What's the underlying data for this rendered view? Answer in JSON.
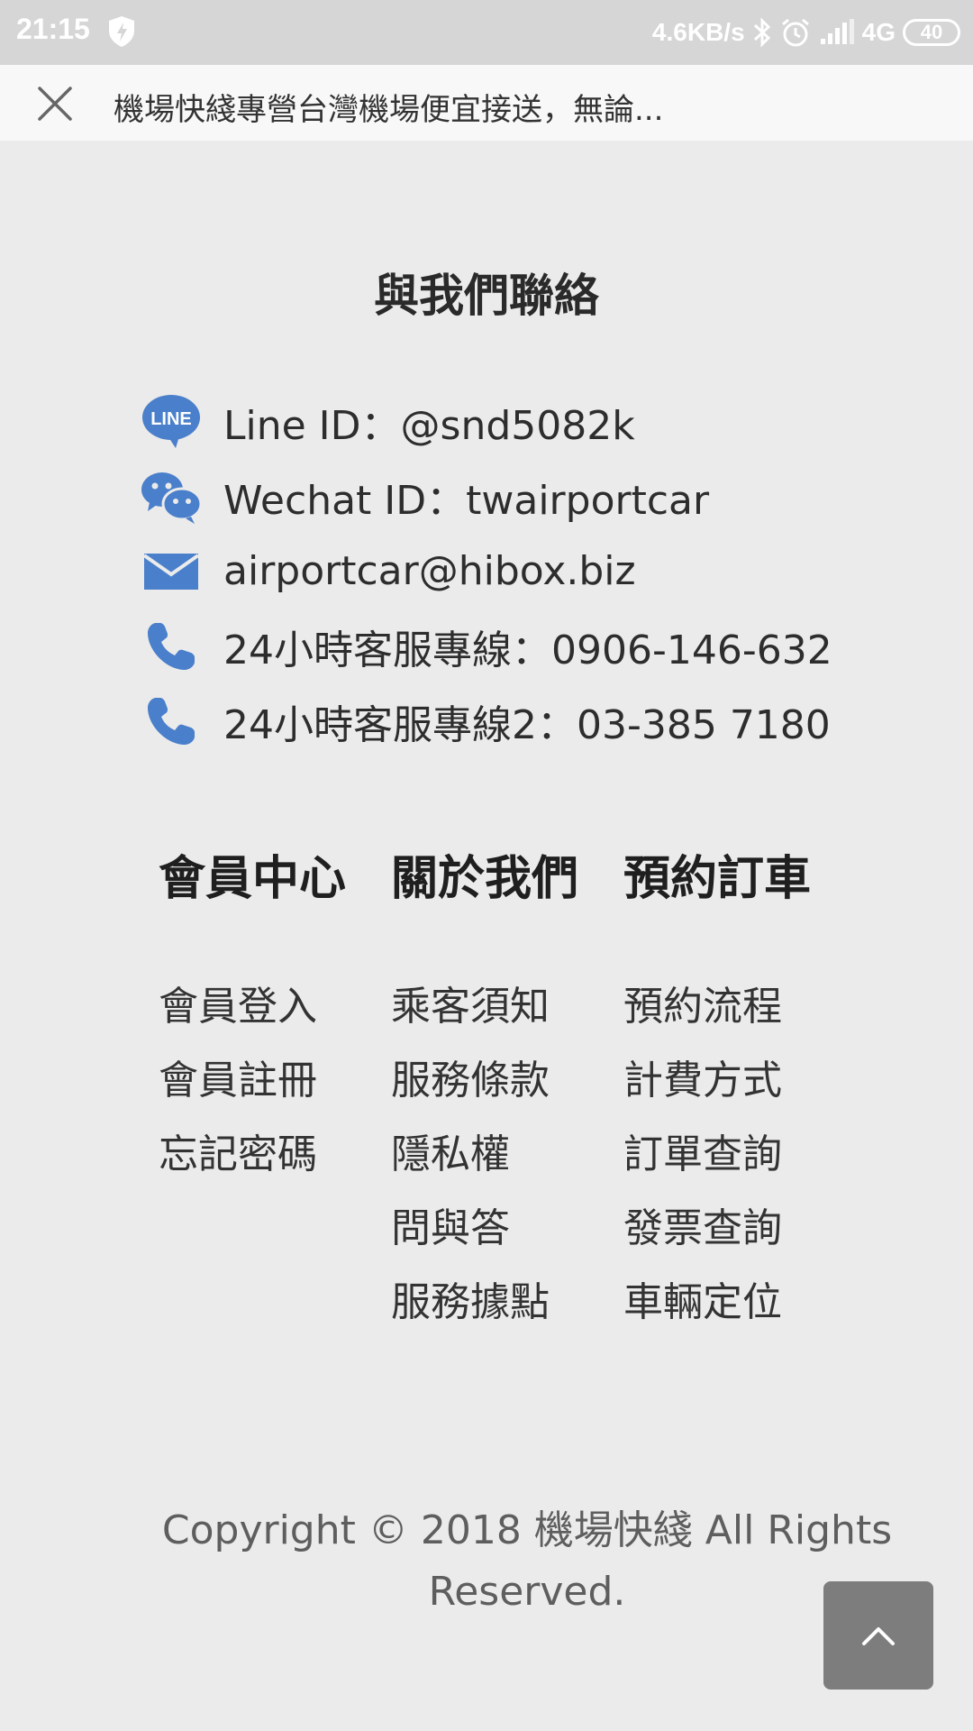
{
  "status_bar": {
    "time": "21:15",
    "net_speed": "4.6KB/s",
    "network": "4G",
    "battery": "40",
    "icons": [
      "shield-icon",
      "bluetooth-icon",
      "alarm-icon",
      "signal-icon"
    ]
  },
  "title_bar": {
    "title": "機場快綫專營台灣機場便宜接送，無論...",
    "close_icon": "close-icon"
  },
  "contact": {
    "heading": "與我們聯絡",
    "items": [
      {
        "icon": "line-icon",
        "text": "Line ID：@snd5082k"
      },
      {
        "icon": "wechat-icon",
        "text": "Wechat ID：twairportcar"
      },
      {
        "icon": "mail-icon",
        "text": "airportcar@hibox.biz"
      },
      {
        "icon": "phone-icon",
        "text": "24小時客服專線：0906-146-632"
      },
      {
        "icon": "phone-icon",
        "text": "24小時客服專線2：03-385 7180"
      }
    ],
    "icon_color": "#4a7fcb"
  },
  "footer": {
    "columns": [
      {
        "heading": "會員中心",
        "links": [
          "會員登入",
          "會員註冊",
          "忘記密碼"
        ]
      },
      {
        "heading": "關於我們",
        "links": [
          "乘客須知",
          "服務條款",
          "隱私權",
          "問與答",
          "服務據點"
        ]
      },
      {
        "heading": "預約訂車",
        "links": [
          "預約流程",
          "計費方式",
          "訂單查詢",
          "發票查詢",
          "車輛定位"
        ]
      }
    ]
  },
  "copyright": {
    "line1": "Copyright © 2018 機場快綫 All Rights",
    "line2": "Reserved."
  },
  "back_to_top": {
    "icon": "chevron-up-icon"
  }
}
